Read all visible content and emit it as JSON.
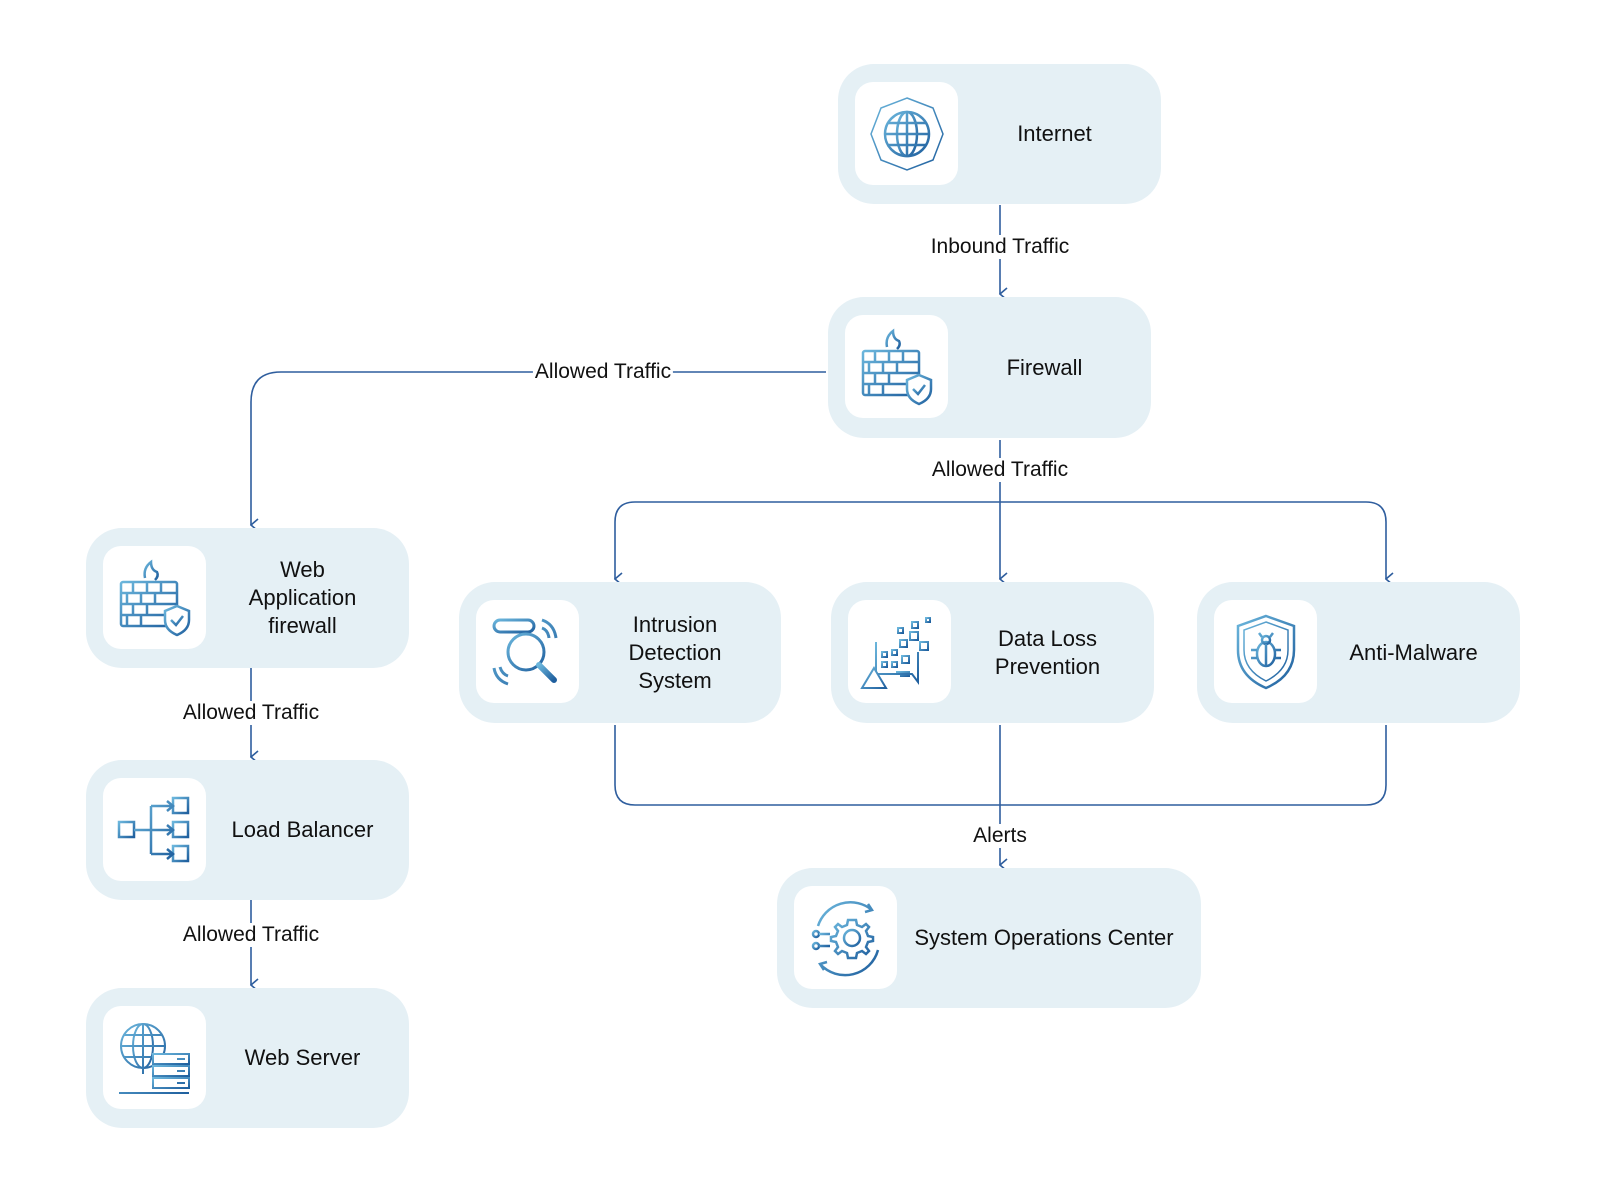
{
  "colors": {
    "box": "#e5f0f5",
    "tile": "#ffffff",
    "line": "#2f5e9e",
    "icon_light": "#6bb6dc",
    "icon_dark": "#1f5f9e"
  },
  "nodes": {
    "internet": {
      "label": "Internet",
      "icon": "globe-network-icon"
    },
    "firewall": {
      "label": "Firewall",
      "icon": "firewall-shield-icon"
    },
    "waf": {
      "label": "Web\nApplication\nfirewall",
      "icon": "firewall-shield-icon"
    },
    "ids": {
      "label": "Intrusion\nDetection\nSystem",
      "icon": "magnifier-alert-icon"
    },
    "dlp": {
      "label": "Data Loss\nPrevention",
      "icon": "document-data-warning-icon"
    },
    "antimalware": {
      "label": "Anti-Malware",
      "icon": "shield-bug-icon"
    },
    "load_balancer": {
      "label": "Load Balancer",
      "icon": "load-balancer-icon"
    },
    "web_server": {
      "label": "Web Server",
      "icon": "globe-server-icon"
    },
    "soc": {
      "label": "System Operations Center",
      "icon": "gear-cycle-icon"
    }
  },
  "edges": {
    "internet_firewall": "Inbound Traffic",
    "firewall_waf": "Allowed Traffic",
    "firewall_branch": "Allowed Traffic",
    "waf_lb": "Allowed Traffic",
    "lb_ws": "Allowed Traffic",
    "alerts": "Alerts"
  }
}
